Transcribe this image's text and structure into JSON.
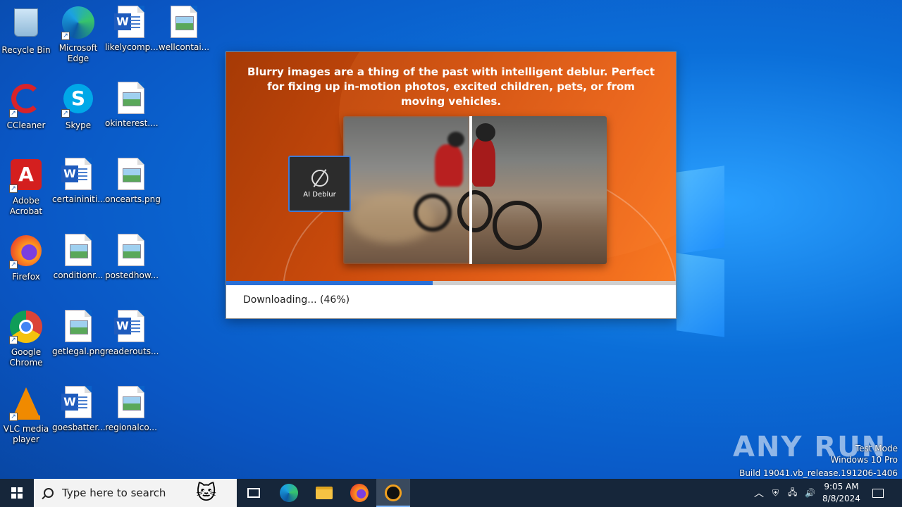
{
  "desktop": {
    "icons": [
      {
        "label": "Recycle Bin"
      },
      {
        "label": "Microsoft Edge"
      },
      {
        "label": "likelycomp..."
      },
      {
        "label": "wellcontai..."
      },
      {
        "label": "CCleaner"
      },
      {
        "label": "Skype"
      },
      {
        "label": "okinterest...."
      },
      {
        "label": "Adobe Acrobat"
      },
      {
        "label": "certaininiti..."
      },
      {
        "label": "oncearts.png"
      },
      {
        "label": "Firefox"
      },
      {
        "label": "conditionr..."
      },
      {
        "label": "postedhow..."
      },
      {
        "label": "Google Chrome"
      },
      {
        "label": "getlegal.png"
      },
      {
        "label": "readerouts..."
      },
      {
        "label": "VLC media player"
      },
      {
        "label": "goesbatter..."
      },
      {
        "label": "regionalco..."
      }
    ]
  },
  "installer": {
    "banner_text": "Blurry images are a thing of the past with intelligent deblur. Perfect for fixing up in-motion photos, excited children, pets, or from moving vehicles.",
    "feature_badge": "AI Deblur",
    "progress": 0.46,
    "status": "Downloading... (46%)",
    "accent": "#2a6fd6"
  },
  "watermark": {
    "logo": "ANY RUN",
    "line1": "Test Mode",
    "line2": "Windows 10 Pro",
    "line3": "Build 19041.vb_release.191206-1406"
  },
  "taskbar": {
    "search_placeholder": "Type here to search",
    "time": "9:05 AM",
    "date": "8/8/2024"
  }
}
